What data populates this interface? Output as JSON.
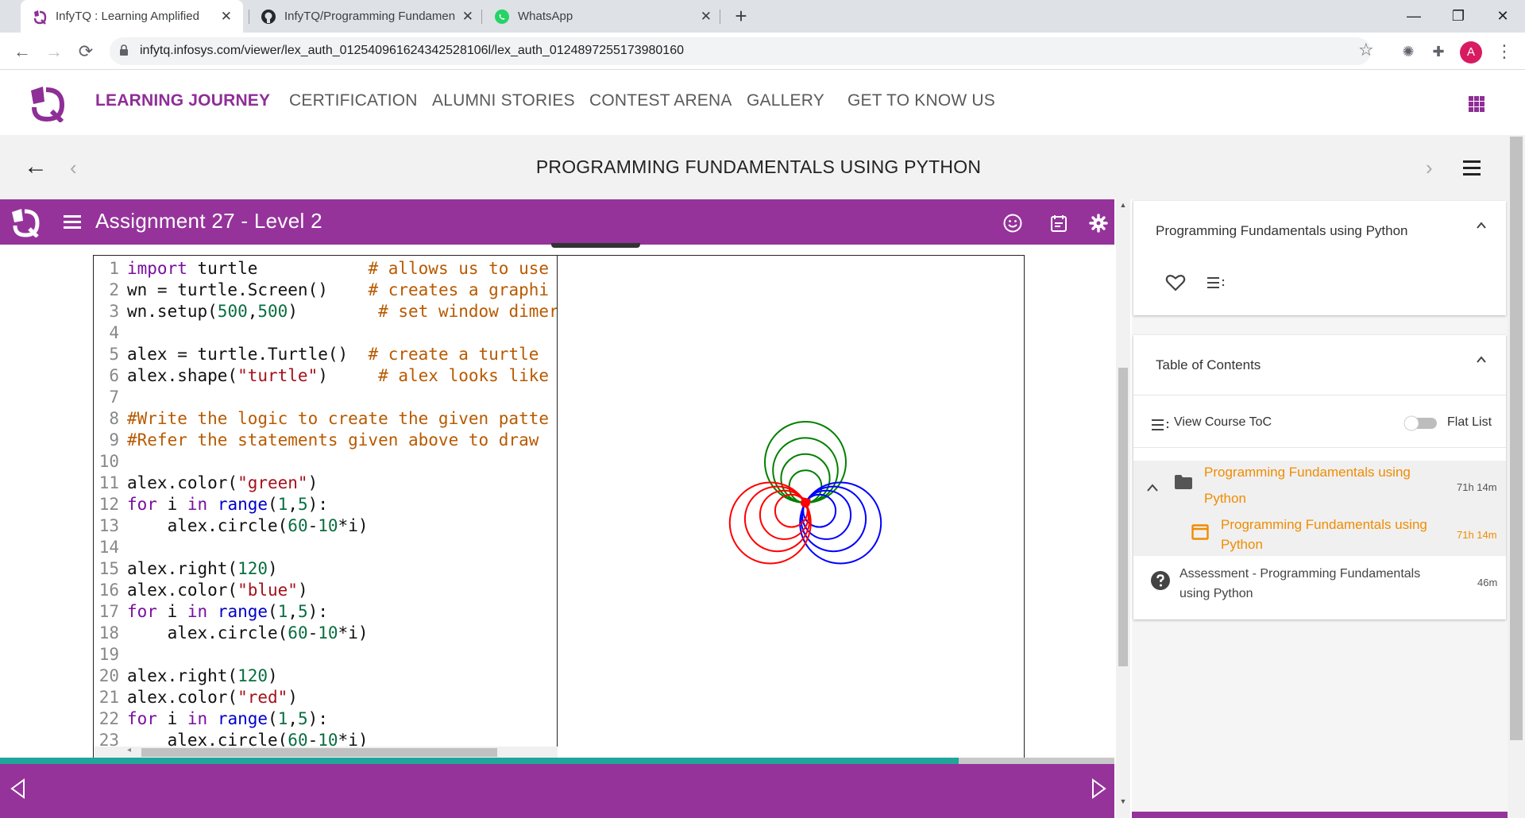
{
  "browser": {
    "tabs": [
      {
        "title": "InfyTQ : Learning Amplified",
        "favicon": "infytq-icon",
        "active": true
      },
      {
        "title": "InfyTQ/Programming Fundamen",
        "favicon": "github-icon",
        "active": false
      },
      {
        "title": "WhatsApp",
        "favicon": "whatsapp-icon",
        "active": false
      }
    ],
    "new_tab_symbol": "+",
    "url": "infytq.infosys.com/viewer/lex_auth_012540961624342528106l/lex_auth_0124897255173980160",
    "profile_initial": "A",
    "window_controls": {
      "minimize": "—",
      "restore": "❐",
      "close": "✕"
    }
  },
  "site_nav": {
    "items": [
      {
        "label": "LEARNING JOURNEY",
        "active": true
      },
      {
        "label": "CERTIFICATION",
        "active": false
      },
      {
        "label": "ALUMNI STORIES",
        "active": false
      },
      {
        "label": "CONTEST ARENA",
        "active": false
      },
      {
        "label": "GALLERY",
        "active": false
      },
      {
        "label": "GET TO KNOW US",
        "active": false
      }
    ],
    "accent_color": "#8e2e97"
  },
  "course_bar": {
    "title": "PROGRAMMING FUNDAMENTALS USING PYTHON",
    "back_symbol": "←",
    "prev_symbol": "‹",
    "next_symbol": "›"
  },
  "assignment": {
    "title": "Assignment 27 - Level 2",
    "bar_color": "#95339b",
    "progress_fraction": 0.86
  },
  "code": {
    "lines": [
      {
        "n": "1",
        "tokens": [
          [
            "kw",
            "import"
          ],
          [
            "t",
            " turtle           "
          ],
          [
            "cmt",
            "# allows us to use"
          ]
        ]
      },
      {
        "n": "2",
        "tokens": [
          [
            "t",
            "wn = turtle.Screen()    "
          ],
          [
            "cmt",
            "# creates a graphi"
          ]
        ]
      },
      {
        "n": "3",
        "tokens": [
          [
            "t",
            "wn.setup("
          ],
          [
            "num",
            "500"
          ],
          [
            "t",
            ","
          ],
          [
            "num",
            "500"
          ],
          [
            "t",
            ")        "
          ],
          [
            "cmt",
            "# set window dimer"
          ]
        ]
      },
      {
        "n": "4",
        "tokens": []
      },
      {
        "n": "5",
        "tokens": [
          [
            "t",
            "alex = turtle.Turtle()  "
          ],
          [
            "cmt",
            "# create a turtle"
          ]
        ]
      },
      {
        "n": "6",
        "tokens": [
          [
            "t",
            "alex.shape("
          ],
          [
            "str",
            "\"turtle\""
          ],
          [
            "t",
            ")     "
          ],
          [
            "cmt",
            "# alex looks like"
          ]
        ]
      },
      {
        "n": "7",
        "tokens": []
      },
      {
        "n": "8",
        "tokens": [
          [
            "cmt",
            "#Write the logic to create the given patte"
          ]
        ]
      },
      {
        "n": "9",
        "tokens": [
          [
            "cmt",
            "#Refer the statements given above to draw"
          ]
        ]
      },
      {
        "n": "10",
        "tokens": []
      },
      {
        "n": "11",
        "tokens": [
          [
            "t",
            "alex.color("
          ],
          [
            "str",
            "\"green\""
          ],
          [
            "t",
            ")"
          ]
        ]
      },
      {
        "n": "12",
        "tokens": [
          [
            "kw",
            "for"
          ],
          [
            "t",
            " i "
          ],
          [
            "kw",
            "in"
          ],
          [
            "t",
            " "
          ],
          [
            "kw2",
            "range"
          ],
          [
            "t",
            "("
          ],
          [
            "num",
            "1"
          ],
          [
            "t",
            ","
          ],
          [
            "num",
            "5"
          ],
          [
            "t",
            "):"
          ]
        ]
      },
      {
        "n": "13",
        "tokens": [
          [
            "t",
            "    alex.circle("
          ],
          [
            "num",
            "60"
          ],
          [
            "t",
            "-"
          ],
          [
            "num",
            "10"
          ],
          [
            "t",
            "*i)"
          ]
        ]
      },
      {
        "n": "14",
        "tokens": []
      },
      {
        "n": "15",
        "tokens": [
          [
            "t",
            "alex.right("
          ],
          [
            "num",
            "120"
          ],
          [
            "t",
            ")"
          ]
        ]
      },
      {
        "n": "16",
        "tokens": [
          [
            "t",
            "alex.color("
          ],
          [
            "str",
            "\"blue\""
          ],
          [
            "t",
            ")"
          ]
        ]
      },
      {
        "n": "17",
        "tokens": [
          [
            "kw",
            "for"
          ],
          [
            "t",
            " i "
          ],
          [
            "kw",
            "in"
          ],
          [
            "t",
            " "
          ],
          [
            "kw2",
            "range"
          ],
          [
            "t",
            "("
          ],
          [
            "num",
            "1"
          ],
          [
            "t",
            ","
          ],
          [
            "num",
            "5"
          ],
          [
            "t",
            "):"
          ]
        ]
      },
      {
        "n": "18",
        "tokens": [
          [
            "t",
            "    alex.circle("
          ],
          [
            "num",
            "60"
          ],
          [
            "t",
            "-"
          ],
          [
            "num",
            "10"
          ],
          [
            "t",
            "*i)"
          ]
        ]
      },
      {
        "n": "19",
        "tokens": []
      },
      {
        "n": "20",
        "tokens": [
          [
            "t",
            "alex.right("
          ],
          [
            "num",
            "120"
          ],
          [
            "t",
            ")"
          ]
        ]
      },
      {
        "n": "21",
        "tokens": [
          [
            "t",
            "alex.color("
          ],
          [
            "str",
            "\"red\""
          ],
          [
            "t",
            ")"
          ]
        ]
      },
      {
        "n": "22",
        "tokens": [
          [
            "kw",
            "for"
          ],
          [
            "t",
            " i "
          ],
          [
            "kw",
            "in"
          ],
          [
            "t",
            " "
          ],
          [
            "kw2",
            "range"
          ],
          [
            "t",
            "("
          ],
          [
            "num",
            "1"
          ],
          [
            "t",
            ","
          ],
          [
            "num",
            "5"
          ],
          [
            "t",
            "):"
          ]
        ]
      },
      {
        "n": "23",
        "tokens": [
          [
            "t",
            "    alex.circle("
          ],
          [
            "num",
            "60"
          ],
          [
            "t",
            "-"
          ],
          [
            "num",
            "10"
          ],
          [
            "t",
            "*i)"
          ]
        ]
      }
    ]
  },
  "turtle_drawing": {
    "colors": [
      "green",
      "blue",
      "red"
    ],
    "radii_per_color": [
      50,
      40,
      30,
      20
    ],
    "heading_turn_degrees": 120,
    "cursor_color": "red"
  },
  "right_panel": {
    "course_card": {
      "title": "Programming Fundamentals using Python"
    },
    "toc": {
      "title": "Table of Contents",
      "view_course_toc": "View Course ToC",
      "flat_list_label": "Flat List",
      "flat_list_on": false,
      "items": [
        {
          "title": "Programming Fundamentals using Python",
          "time": "71h 14m",
          "icon": "folder-icon"
        },
        {
          "title": "Programming Fundamentals using Python",
          "time": "71h 14m",
          "icon": "module-icon"
        },
        {
          "title": "Assessment - Programming Fundamentals using Python",
          "time": "46m",
          "icon": "help-circle-icon"
        }
      ]
    }
  }
}
